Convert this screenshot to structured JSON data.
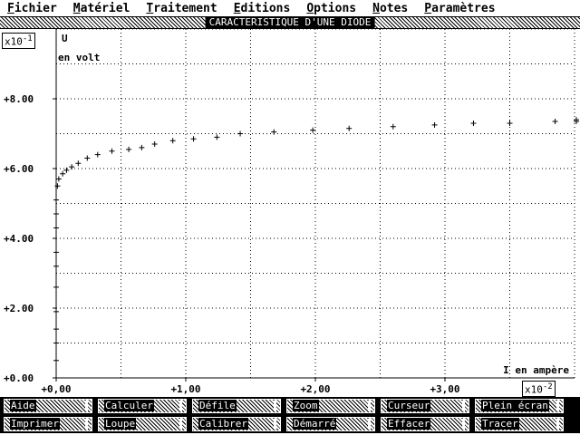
{
  "menu": [
    {
      "label": "Fichier"
    },
    {
      "label": "Matériel"
    },
    {
      "label": "Traitement"
    },
    {
      "label": "Editions"
    },
    {
      "label": "Options"
    },
    {
      "label": "Notes"
    },
    {
      "label": "Paramètres"
    }
  ],
  "window_title": "CARACTERISTIQUE D'UNE DIODE",
  "y_scale_label": "x10",
  "y_scale_exp": "-1",
  "x_scale_label": "x10",
  "x_scale_exp": "-2",
  "buttons_row1": [
    "Aide",
    "Calculer",
    "Défile",
    "Zoom",
    "Curseur",
    "Plein écran"
  ],
  "buttons_row2": [
    "Imprimer",
    "Loupe",
    "Calibrer",
    "Démarré",
    "Effacer",
    "Tracer"
  ],
  "colors": {
    "foreground": "#000000",
    "background": "#ffffff"
  },
  "chart_data": {
    "type": "scatter",
    "marker": "+",
    "xlabel": "I en ampère",
    "ylabel_line1": "U",
    "ylabel_line2": "en volt",
    "x_ticks": [
      "+0,00",
      "+1,00",
      "+2,00",
      "+3,00"
    ],
    "y_ticks": [
      "+0.00",
      "+2.00",
      "+4.00",
      "+6.00",
      "+8.00"
    ],
    "xlim": [
      0,
      4.0
    ],
    "ylim": [
      0,
      10.0
    ],
    "grid": "dotted",
    "series": [
      {
        "x": [
          0.0,
          0.0,
          0.0,
          0.0,
          0.0,
          0.0,
          0.0,
          0.0,
          0.0,
          0.0,
          0.01,
          0.02,
          0.05,
          0.08,
          0.12,
          0.17,
          0.24,
          0.32,
          0.43,
          0.56,
          0.66,
          0.76,
          0.9,
          1.06,
          1.24,
          1.42,
          1.68,
          1.98,
          2.26,
          2.6,
          2.92,
          3.22,
          3.5,
          3.85,
          4.05,
          4.25
        ],
        "y": [
          0.5,
          1.0,
          1.4,
          1.9,
          2.6,
          3.2,
          3.6,
          4.3,
          4.7,
          5.1,
          5.5,
          5.7,
          5.85,
          5.95,
          6.05,
          6.15,
          6.3,
          6.4,
          6.5,
          6.55,
          6.6,
          6.7,
          6.8,
          6.85,
          6.9,
          7.0,
          7.05,
          7.1,
          7.15,
          7.2,
          7.25,
          7.3,
          7.3,
          7.35,
          7.35,
          7.4
        ]
      }
    ]
  }
}
